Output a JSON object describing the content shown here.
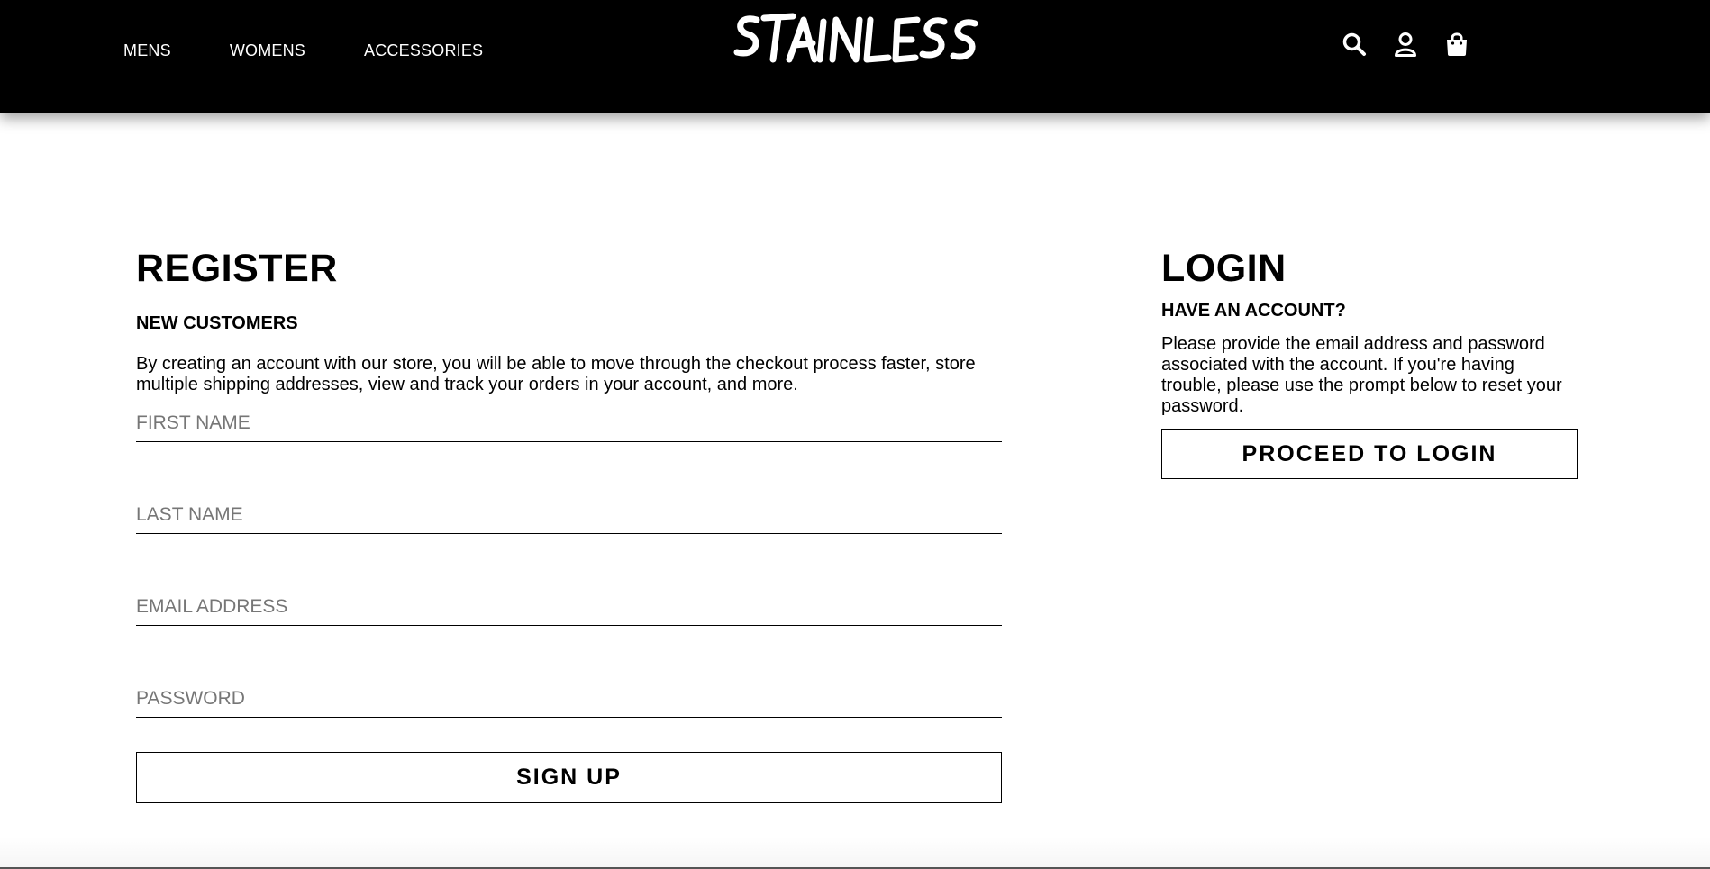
{
  "header": {
    "nav": [
      "MENS",
      "WOMENS",
      "ACCESSORIES"
    ],
    "logo_text": "STAINLESS",
    "icons": [
      "search-icon",
      "account-icon",
      "shopping-bag-icon"
    ],
    "background": "#000000"
  },
  "register": {
    "title": "REGISTER",
    "subtitle": "NEW CUSTOMERS",
    "description": "By creating an account with our store, you will be able to move through the checkout process faster, store multiple shipping addresses, view and track your orders in your account, and more.",
    "fields": [
      {
        "placeholder": "FIRST NAME",
        "value": ""
      },
      {
        "placeholder": "LAST NAME",
        "value": ""
      },
      {
        "placeholder": "EMAIL ADDRESS",
        "value": ""
      },
      {
        "placeholder": "PASSWORD",
        "value": ""
      }
    ],
    "button_label": "SIGN UP"
  },
  "login": {
    "title": "LOGIN",
    "subtitle": "HAVE AN ACCOUNT?",
    "description": "Please provide the email address and password associated with the account. If you're having trouble, please use the prompt below to reset your password.",
    "button_label": "PROCEED TO LOGIN"
  }
}
